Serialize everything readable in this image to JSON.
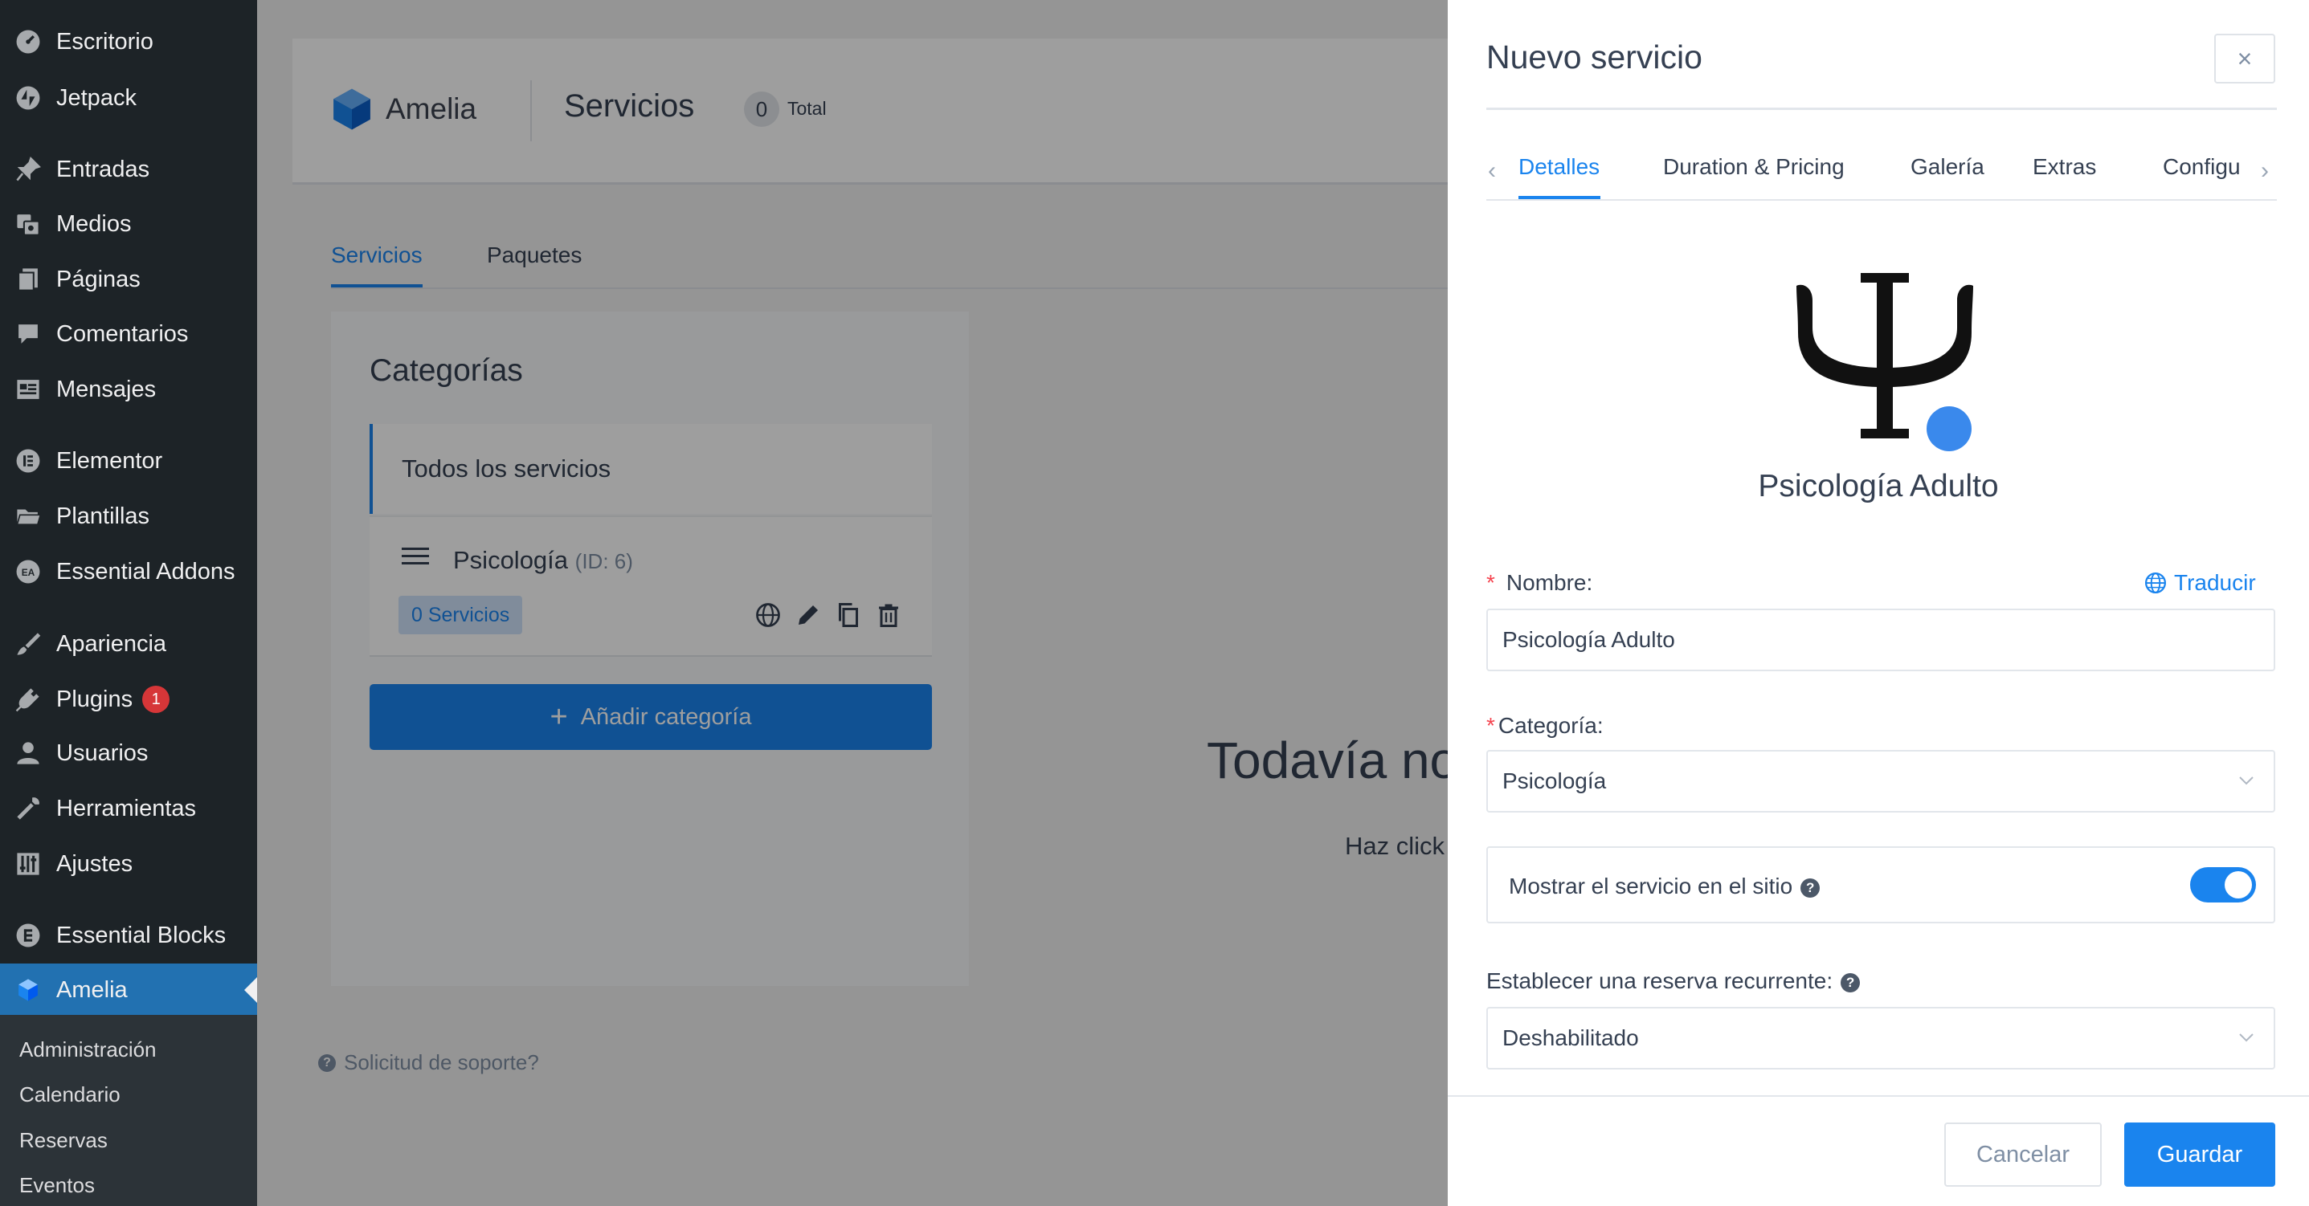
{
  "sidebar": {
    "items": [
      {
        "label": "Escritorio",
        "icon": "dashboard-icon"
      },
      {
        "label": "Jetpack",
        "icon": "jetpack-icon"
      },
      {
        "label": "Entradas",
        "icon": "pin-icon"
      },
      {
        "label": "Medios",
        "icon": "media-icon"
      },
      {
        "label": "Páginas",
        "icon": "pages-icon"
      },
      {
        "label": "Comentarios",
        "icon": "comment-icon"
      },
      {
        "label": "Mensajes",
        "icon": "messages-icon"
      },
      {
        "label": "Elementor",
        "icon": "elementor-icon"
      },
      {
        "label": "Plantillas",
        "icon": "folder-icon"
      },
      {
        "label": "Essential Addons",
        "icon": "essential-addons-icon"
      },
      {
        "label": "Apariencia",
        "icon": "brush-icon"
      },
      {
        "label": "Plugins",
        "icon": "plugin-icon",
        "badge": "1"
      },
      {
        "label": "Usuarios",
        "icon": "user-icon"
      },
      {
        "label": "Herramientas",
        "icon": "wrench-icon"
      },
      {
        "label": "Ajustes",
        "icon": "settings-icon"
      },
      {
        "label": "Essential Blocks",
        "icon": "essential-blocks-icon"
      },
      {
        "label": "Amelia",
        "icon": "amelia-icon",
        "active": true
      }
    ],
    "submenu": [
      "Administración",
      "Calendario",
      "Reservas",
      "Eventos"
    ]
  },
  "header": {
    "brand": "Amelia",
    "title": "Servicios",
    "count": "0",
    "count_label": "Total"
  },
  "tabs": [
    "Servicios",
    "Paquetes"
  ],
  "categories": {
    "title": "Categorías",
    "all_label": "Todos los servicios",
    "items": [
      {
        "name": "Psicología",
        "id_label": "(ID: 6)",
        "badge": "0 Servicios"
      }
    ],
    "add_button": "Añadir categoría"
  },
  "empty_state": {
    "title": "Todavía no",
    "subtitle": "Haz click"
  },
  "support_link": "Solicitud de soporte?",
  "drawer": {
    "title": "Nuevo servicio",
    "close_label": "×",
    "tabs": [
      "Detalles",
      "Duration & Pricing",
      "Galería",
      "Extras",
      "Configu"
    ],
    "service_name": "Psicología Adulto",
    "name_label": "Nombre:",
    "translate_label": "Traducir",
    "name_value": "Psicología Adulto",
    "category_label": "Categoría:",
    "category_value": "Psicología",
    "show_label": "Mostrar el servicio en el sitio",
    "show_enabled": true,
    "recurring_label": "Establecer una reserva recurrente:",
    "recurring_value": "Deshabilitado",
    "cancel_label": "Cancelar",
    "save_label": "Guardar"
  },
  "colors": {
    "accent": "#1a84ee",
    "wp_sidebar": "#1d2327",
    "wp_active": "#2271b1",
    "badge_red": "#d63638",
    "required": "#f5444f"
  }
}
